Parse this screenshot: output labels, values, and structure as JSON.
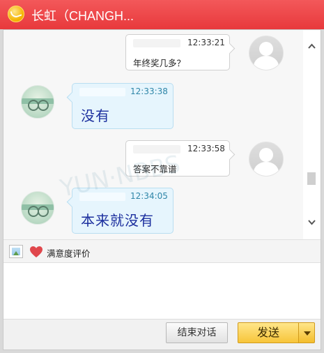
{
  "window": {
    "title": "长虹（CHANGH..."
  },
  "messages": [
    {
      "side": "right",
      "time": "12:33:21",
      "text": "年终奖几多？"
    },
    {
      "side": "left",
      "time": "12:33:38",
      "text": "没有"
    },
    {
      "side": "right",
      "time": "12:33:58",
      "text": "答案不靠谱"
    },
    {
      "side": "left",
      "time": "12:34:05",
      "text": "本来就没有"
    }
  ],
  "watermark": "YUN·NBBS",
  "toolbar": {
    "rating_label": "满意度评价"
  },
  "footer": {
    "end_chat_label": "结束对话",
    "send_label": "发送"
  },
  "icons": {
    "logo": "app-logo-icon",
    "image": "image-icon",
    "rating": "heart-icon",
    "scroll_up": "chevron-up-icon",
    "scroll_down": "chevron-down-icon",
    "send_menu": "caret-down-icon"
  },
  "colors": {
    "title_bar": "#e8393c",
    "send_button": "#f7c53a",
    "agent_bubble": "#e6f5fd"
  }
}
